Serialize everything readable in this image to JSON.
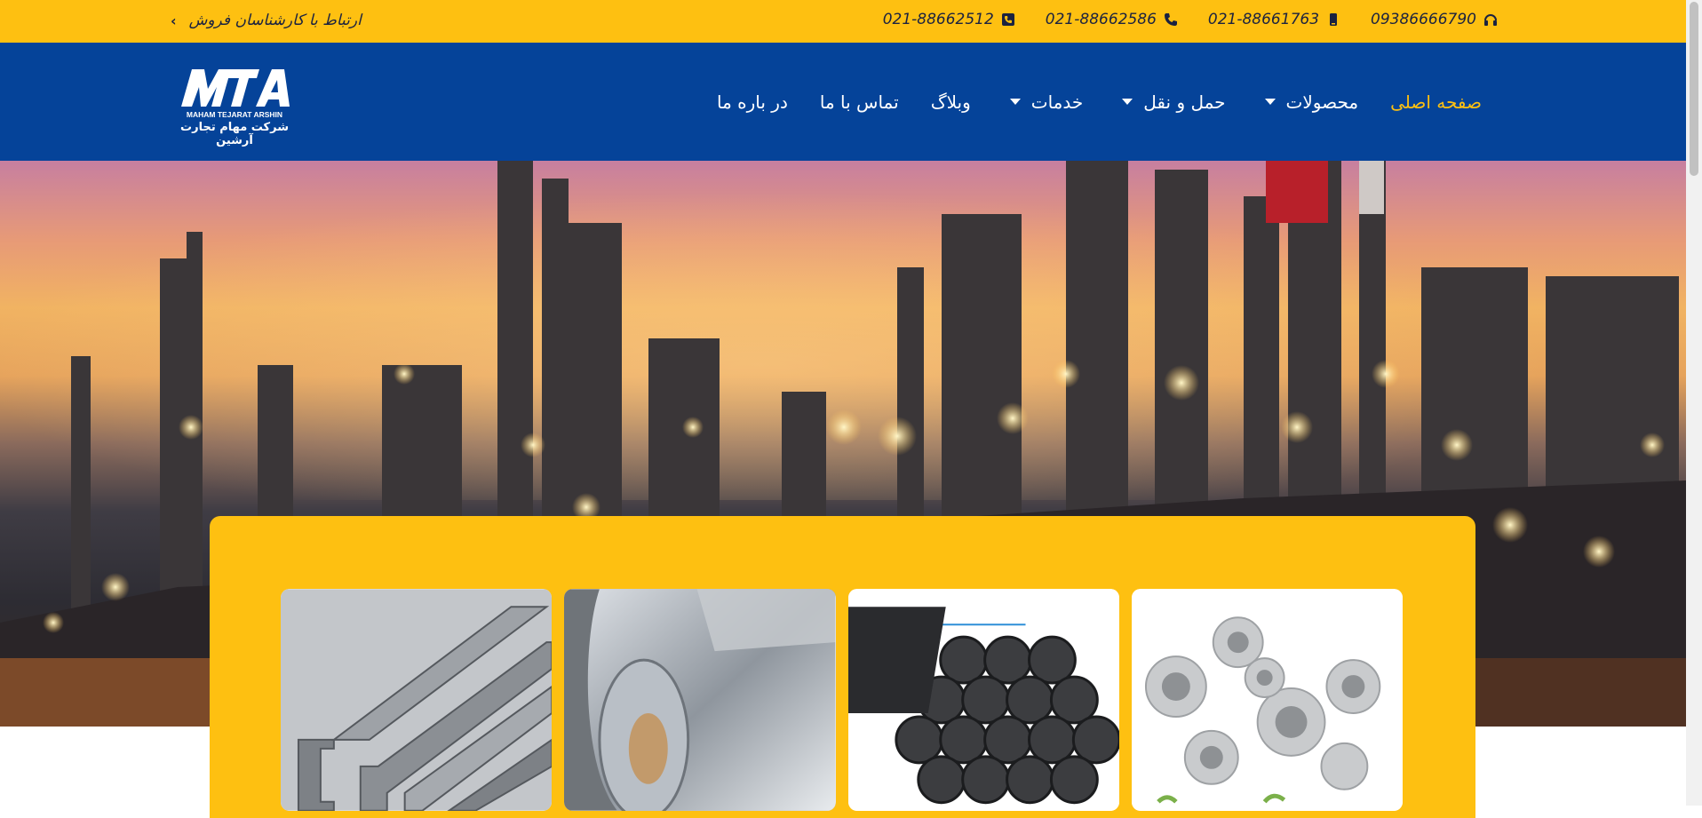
{
  "topbar": {
    "contacts": [
      {
        "icon": "headset-icon",
        "text": "09386666790"
      },
      {
        "icon": "mobile-icon",
        "text": "021-88661763"
      },
      {
        "icon": "phone-icon",
        "text": "021-88662586"
      },
      {
        "icon": "fax-icon",
        "text": "021-88662512"
      }
    ],
    "sales_link": "ارتباط با کارشناسان فروش"
  },
  "logo": {
    "mark": "MTA",
    "sub_en": "MAHAM TEJARAT ARSHIN",
    "sub_fa": "شرکت مهام تجارت آرشین"
  },
  "nav": {
    "items": [
      {
        "label": "صفحه اصلی",
        "active": true,
        "dropdown": false
      },
      {
        "label": "محصولات",
        "active": false,
        "dropdown": true
      },
      {
        "label": "حمل و نقل",
        "active": false,
        "dropdown": true
      },
      {
        "label": "خدمات",
        "active": false,
        "dropdown": true
      },
      {
        "label": "وبلاگ",
        "active": false,
        "dropdown": false
      },
      {
        "label": "تماس با ما",
        "active": false,
        "dropdown": false
      },
      {
        "label": "در باره ما",
        "active": false,
        "dropdown": false
      }
    ]
  },
  "colors": {
    "topbar": "#fec011",
    "navbar": "#054399",
    "active_nav": "#fec011",
    "panel": "#fec011"
  },
  "cards": [
    {
      "image": "pvc-fittings"
    },
    {
      "image": "hdpe-pipes"
    },
    {
      "image": "metal-coils"
    },
    {
      "image": "steel-profiles"
    }
  ]
}
